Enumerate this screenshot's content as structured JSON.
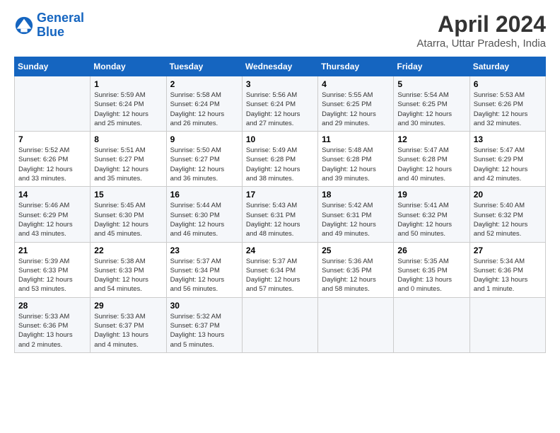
{
  "logo": {
    "line1": "General",
    "line2": "Blue"
  },
  "title": "April 2024",
  "subtitle": "Atarra, Uttar Pradesh, India",
  "weekdays": [
    "Sunday",
    "Monday",
    "Tuesday",
    "Wednesday",
    "Thursday",
    "Friday",
    "Saturday"
  ],
  "weeks": [
    [
      {
        "day": "",
        "info": ""
      },
      {
        "day": "1",
        "info": "Sunrise: 5:59 AM\nSunset: 6:24 PM\nDaylight: 12 hours\nand 25 minutes."
      },
      {
        "day": "2",
        "info": "Sunrise: 5:58 AM\nSunset: 6:24 PM\nDaylight: 12 hours\nand 26 minutes."
      },
      {
        "day": "3",
        "info": "Sunrise: 5:56 AM\nSunset: 6:24 PM\nDaylight: 12 hours\nand 27 minutes."
      },
      {
        "day": "4",
        "info": "Sunrise: 5:55 AM\nSunset: 6:25 PM\nDaylight: 12 hours\nand 29 minutes."
      },
      {
        "day": "5",
        "info": "Sunrise: 5:54 AM\nSunset: 6:25 PM\nDaylight: 12 hours\nand 30 minutes."
      },
      {
        "day": "6",
        "info": "Sunrise: 5:53 AM\nSunset: 6:26 PM\nDaylight: 12 hours\nand 32 minutes."
      }
    ],
    [
      {
        "day": "7",
        "info": "Sunrise: 5:52 AM\nSunset: 6:26 PM\nDaylight: 12 hours\nand 33 minutes."
      },
      {
        "day": "8",
        "info": "Sunrise: 5:51 AM\nSunset: 6:27 PM\nDaylight: 12 hours\nand 35 minutes."
      },
      {
        "day": "9",
        "info": "Sunrise: 5:50 AM\nSunset: 6:27 PM\nDaylight: 12 hours\nand 36 minutes."
      },
      {
        "day": "10",
        "info": "Sunrise: 5:49 AM\nSunset: 6:28 PM\nDaylight: 12 hours\nand 38 minutes."
      },
      {
        "day": "11",
        "info": "Sunrise: 5:48 AM\nSunset: 6:28 PM\nDaylight: 12 hours\nand 39 minutes."
      },
      {
        "day": "12",
        "info": "Sunrise: 5:47 AM\nSunset: 6:28 PM\nDaylight: 12 hours\nand 40 minutes."
      },
      {
        "day": "13",
        "info": "Sunrise: 5:47 AM\nSunset: 6:29 PM\nDaylight: 12 hours\nand 42 minutes."
      }
    ],
    [
      {
        "day": "14",
        "info": "Sunrise: 5:46 AM\nSunset: 6:29 PM\nDaylight: 12 hours\nand 43 minutes."
      },
      {
        "day": "15",
        "info": "Sunrise: 5:45 AM\nSunset: 6:30 PM\nDaylight: 12 hours\nand 45 minutes."
      },
      {
        "day": "16",
        "info": "Sunrise: 5:44 AM\nSunset: 6:30 PM\nDaylight: 12 hours\nand 46 minutes."
      },
      {
        "day": "17",
        "info": "Sunrise: 5:43 AM\nSunset: 6:31 PM\nDaylight: 12 hours\nand 48 minutes."
      },
      {
        "day": "18",
        "info": "Sunrise: 5:42 AM\nSunset: 6:31 PM\nDaylight: 12 hours\nand 49 minutes."
      },
      {
        "day": "19",
        "info": "Sunrise: 5:41 AM\nSunset: 6:32 PM\nDaylight: 12 hours\nand 50 minutes."
      },
      {
        "day": "20",
        "info": "Sunrise: 5:40 AM\nSunset: 6:32 PM\nDaylight: 12 hours\nand 52 minutes."
      }
    ],
    [
      {
        "day": "21",
        "info": "Sunrise: 5:39 AM\nSunset: 6:33 PM\nDaylight: 12 hours\nand 53 minutes."
      },
      {
        "day": "22",
        "info": "Sunrise: 5:38 AM\nSunset: 6:33 PM\nDaylight: 12 hours\nand 54 minutes."
      },
      {
        "day": "23",
        "info": "Sunrise: 5:37 AM\nSunset: 6:34 PM\nDaylight: 12 hours\nand 56 minutes."
      },
      {
        "day": "24",
        "info": "Sunrise: 5:37 AM\nSunset: 6:34 PM\nDaylight: 12 hours\nand 57 minutes."
      },
      {
        "day": "25",
        "info": "Sunrise: 5:36 AM\nSunset: 6:35 PM\nDaylight: 12 hours\nand 58 minutes."
      },
      {
        "day": "26",
        "info": "Sunrise: 5:35 AM\nSunset: 6:35 PM\nDaylight: 13 hours\nand 0 minutes."
      },
      {
        "day": "27",
        "info": "Sunrise: 5:34 AM\nSunset: 6:36 PM\nDaylight: 13 hours\nand 1 minute."
      }
    ],
    [
      {
        "day": "28",
        "info": "Sunrise: 5:33 AM\nSunset: 6:36 PM\nDaylight: 13 hours\nand 2 minutes."
      },
      {
        "day": "29",
        "info": "Sunrise: 5:33 AM\nSunset: 6:37 PM\nDaylight: 13 hours\nand 4 minutes."
      },
      {
        "day": "30",
        "info": "Sunrise: 5:32 AM\nSunset: 6:37 PM\nDaylight: 13 hours\nand 5 minutes."
      },
      {
        "day": "",
        "info": ""
      },
      {
        "day": "",
        "info": ""
      },
      {
        "day": "",
        "info": ""
      },
      {
        "day": "",
        "info": ""
      }
    ]
  ]
}
